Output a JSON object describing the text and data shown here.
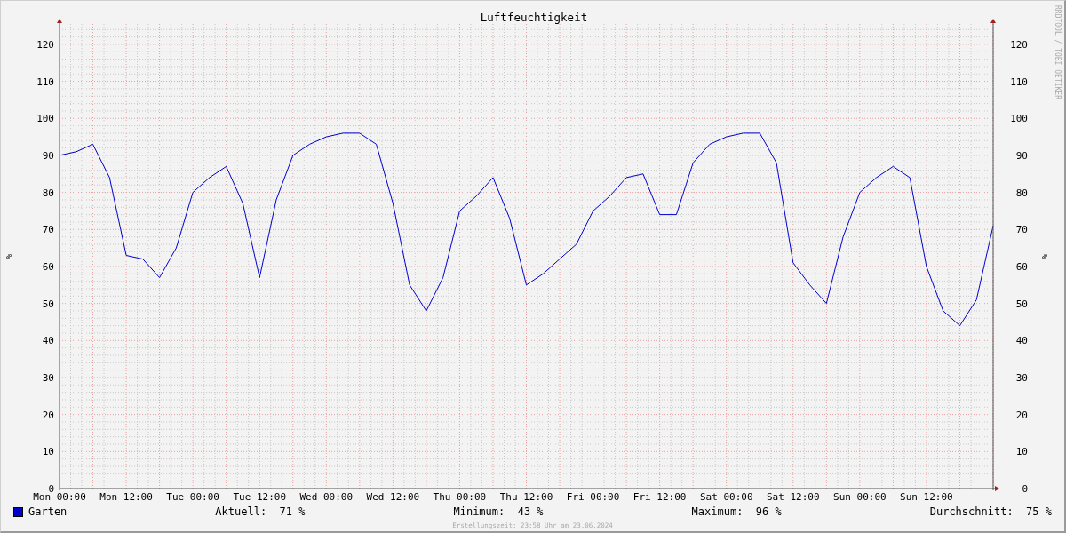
{
  "chart_data": {
    "type": "line",
    "title": "Luftfeuchtigkeit",
    "ylabel": "%",
    "categories": [
      "Mon 00:00",
      null,
      null,
      null,
      "Mon 12:00",
      null,
      null,
      null,
      "Tue 00:00",
      null,
      null,
      null,
      "Tue 12:00",
      null,
      null,
      null,
      "Wed 00:00",
      null,
      null,
      null,
      "Wed 12:00",
      null,
      null,
      null,
      "Thu 00:00",
      null,
      null,
      null,
      "Thu 12:00",
      null,
      null,
      null,
      "Fri 00:00",
      null,
      null,
      null,
      "Fri 12:00",
      null,
      null,
      null,
      "Sat 00:00",
      null,
      null,
      null,
      "Sat 12:00",
      null,
      null,
      null,
      "Sun 00:00",
      null,
      null,
      null,
      "Sun 12:00",
      null,
      null,
      null,
      null
    ],
    "series": [
      {
        "name": "Garten",
        "color": "#0000cc",
        "values": [
          90,
          91,
          93,
          84,
          63,
          62,
          57,
          65,
          80,
          84,
          87,
          77,
          57,
          78,
          90,
          93,
          95,
          96,
          96,
          93,
          77,
          55,
          48,
          57,
          75,
          79,
          84,
          73,
          55,
          58,
          62,
          66,
          75,
          79,
          84,
          85,
          74,
          74,
          88,
          93,
          95,
          96,
          96,
          88,
          61,
          55,
          50,
          68,
          80,
          84,
          87,
          84,
          60,
          48,
          44,
          51,
          71
        ]
      }
    ],
    "ylim": [
      0,
      125.5
    ],
    "grid": true,
    "yticks": [
      0,
      10,
      20,
      30,
      40,
      50,
      60,
      70,
      80,
      90,
      100,
      110,
      120
    ]
  },
  "right_axis": {
    "title": "%",
    "ticks": [
      "120",
      "110",
      "100",
      "90",
      "80",
      "70",
      "60",
      "50",
      "40",
      "30",
      "20",
      "10",
      "0"
    ]
  },
  "watermark_label": "RRDTOOL / TOBI OETIKER",
  "stats": [
    "Aktuell:  71 %",
    "Minimum:  43 %",
    "Maximum:  96 %",
    "Durchschnitt:  75 %"
  ],
  "footer": "Erstellungszeit: 23:58 Uhr am 23.06.2024"
}
